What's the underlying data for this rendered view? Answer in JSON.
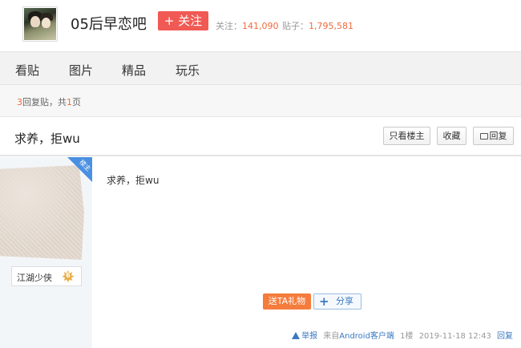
{
  "forum": {
    "name": "05后早恋吧",
    "follow_label": "+ 关注",
    "followers_label": "关注：",
    "followers_value": "141,090",
    "posts_label": "贴子：",
    "posts_value": "1,795,581"
  },
  "nav": {
    "tabs": [
      {
        "label": "看贴"
      },
      {
        "label": "图片"
      },
      {
        "label": "精品"
      },
      {
        "label": "玩乐"
      }
    ]
  },
  "pager": {
    "reply_count": "3",
    "reply_text": "回复贴，共",
    "page_count": "1",
    "page_text": "页"
  },
  "thread": {
    "title": "求养，拒wu",
    "buttons": {
      "only_op": "只看楼主",
      "favorite": "收藏",
      "reply": "回复"
    }
  },
  "post": {
    "op_badge": "楼主",
    "author": "江湖少侠",
    "level": "6",
    "content": "求养，拒wu",
    "gift_label": "送TA礼物",
    "share_label": "分享",
    "meta": {
      "report": "举报",
      "from_prefix": "来自",
      "client": "Android客户端",
      "floor": "1楼",
      "time": "2019-11-18 12:43",
      "reply": "回复"
    }
  },
  "colors": {
    "accent_red": "#f15a54",
    "number_orange": "#f06a3c",
    "link_blue": "#3b79c0",
    "op_badge_blue": "#4a90e2"
  }
}
